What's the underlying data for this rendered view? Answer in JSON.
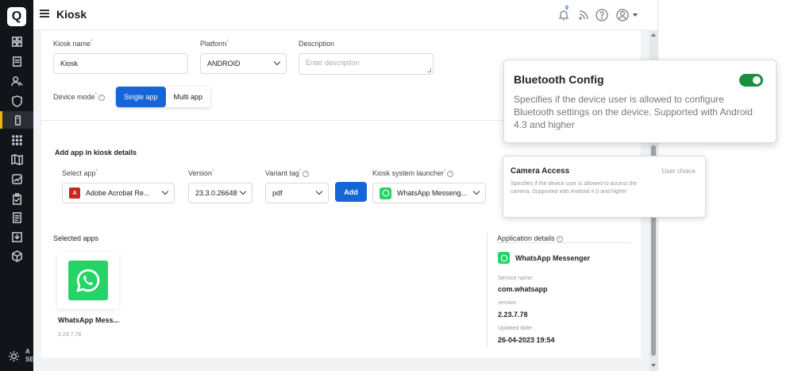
{
  "header": {
    "title": "Kiosk",
    "notification_count": "0"
  },
  "sidebar": {
    "logo": "Q",
    "footer_text": "A\nSE",
    "items": [
      "grid-icon",
      "doc-icon",
      "users-icon",
      "shield-icon",
      "kiosk-icon",
      "apps-icon",
      "map-icon",
      "chart-icon",
      "clipboard-icon",
      "list-icon",
      "download-icon",
      "cube-icon"
    ]
  },
  "form": {
    "kiosk_name_label": "Kiosk name",
    "kiosk_name_value": "Kiosk",
    "platform_label": "Platform",
    "platform_value": "ANDROID",
    "description_label": "Description",
    "description_placeholder": "Enter description",
    "device_mode_label": "Device mode",
    "mode_single": "Single app",
    "mode_multi": "Multi app"
  },
  "add_app": {
    "section_title": "Add app in kiosk details",
    "select_app_label": "Select app",
    "select_app_value": "Adobe Acrobat Re...",
    "version_label": "Version",
    "version_value": "23.3.0.26648",
    "variant_label": "Variant tag",
    "variant_value": "pdf",
    "add_button": "Add",
    "launcher_label": "Kiosk system launcher",
    "launcher_value": "WhatsApp Messeng..."
  },
  "selected": {
    "section_title": "Selected apps",
    "app_name": "WhatsApp Mess...",
    "app_version": "2.23.7.78"
  },
  "details": {
    "title": "Application details",
    "app_name": "WhatsApp Messenger",
    "service_label": "Service name:",
    "service_value": "com.whatsapp",
    "version_label": "version:",
    "version_value": "2.23.7.78",
    "updated_label": "Updated date:",
    "updated_value": "26-04-2023 19:54"
  },
  "popup_bluetooth": {
    "title": "Bluetooth Config",
    "description": "Specifies if the device user is allowed to configure Bluetooth settings on the device. Supported with Android 4.3 and higher",
    "enabled": true
  },
  "popup_camera": {
    "title": "Camera Access",
    "choice": "User choice",
    "description": "Specifies if the device user is allowed to access the camera. Supported with Android 4.0 and higher"
  },
  "colors": {
    "primary": "#1565d8",
    "sidebar": "#111418",
    "active_marker": "#f0b400",
    "toggle_on": "#1a8f3e",
    "whatsapp": "#25d366",
    "pdf": "#c9271f"
  }
}
